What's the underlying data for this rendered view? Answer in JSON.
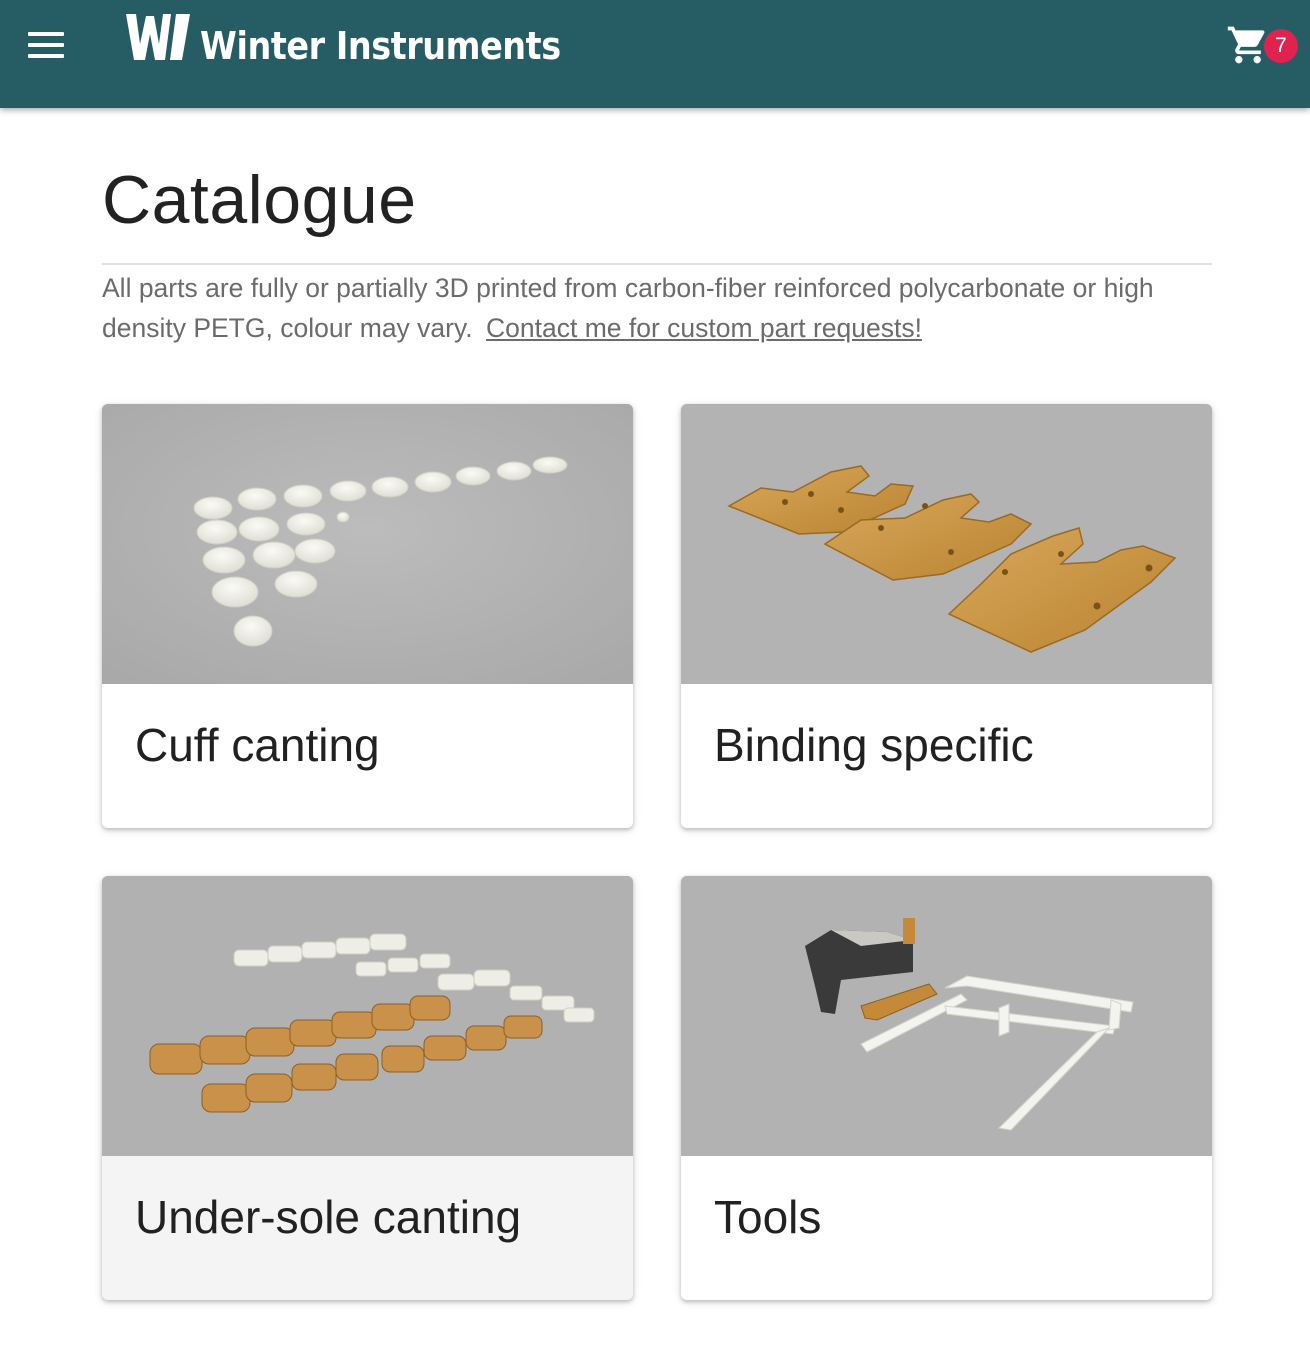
{
  "header": {
    "brand_name": "Winter Instruments",
    "logo_mark": "WI",
    "menu_icon": "hamburger-menu-icon",
    "cart_icon": "shopping-cart-icon",
    "cart_count": "7",
    "colors": {
      "bar": "#265c63",
      "badge": "#e0224f"
    }
  },
  "main": {
    "title": "Catalogue",
    "intro_text": "All parts are fully or partially 3D printed from carbon-fiber reinforced polycarbonate or high density PETG, colour may vary.",
    "contact_link": "Contact me for custom part requests!"
  },
  "categories": [
    {
      "title": "Cuff canting"
    },
    {
      "title": "Binding specific"
    },
    {
      "title": "Under-sole canting"
    },
    {
      "title": "Tools"
    }
  ]
}
